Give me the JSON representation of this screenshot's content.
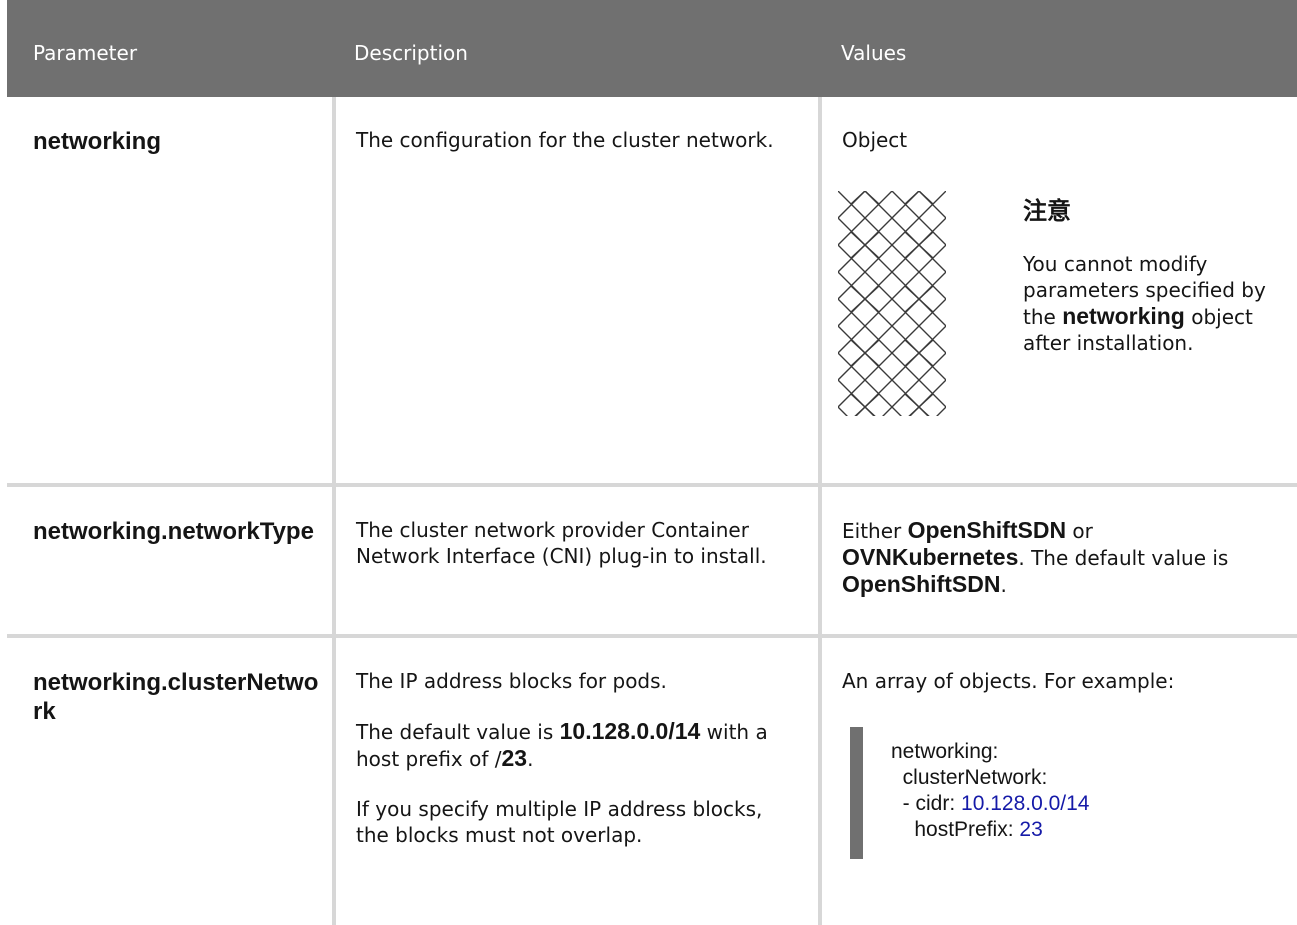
{
  "header": {
    "col_parameter": "Parameter",
    "col_description": "Description",
    "col_values": "Values"
  },
  "rows": [
    {
      "parameter": "networking",
      "description": "The configuration for the cluster network.",
      "value": "Object",
      "note": {
        "icon": "warning-pattern-icon",
        "title": "注意",
        "text_before": "You cannot modify parameters specified by the ",
        "text_strong": "networking",
        "text_after": " object after installation."
      }
    },
    {
      "parameter": "networking.networkType",
      "description": "The cluster network provider Container Network Interface (CNI) plug-in to install.",
      "value_parts": {
        "p1": "Either ",
        "s1": "OpenShiftSDN",
        "p2": " or ",
        "s2": "OVNKubernetes",
        "p3": ". The default value is ",
        "s3": "OpenShiftSDN",
        "p4": "."
      }
    },
    {
      "parameter": "networking.clusterNetwork",
      "description": {
        "p1": "The IP address blocks for pods.",
        "p2_before": "The default value is ",
        "p2_strong": "10.128.0.0/14",
        "p2_mid": " with a host prefix of /",
        "p2_strong2": "23",
        "p2_after": ".",
        "p3": "If you specify multiple IP address blocks, the blocks must not overlap."
      },
      "value_intro": "An array of objects. For example:",
      "code": {
        "l1": "networking:",
        "l2": "  clusterNetwork:",
        "l3_key": "  - cidr: ",
        "l3_val": "10.128.0.0/14",
        "l4_key": "    hostPrefix: ",
        "l4_val": "23"
      }
    }
  ],
  "colors": {
    "header_bg": "#707070",
    "border": "#d7d7d7",
    "code_number": "#151aa8"
  }
}
